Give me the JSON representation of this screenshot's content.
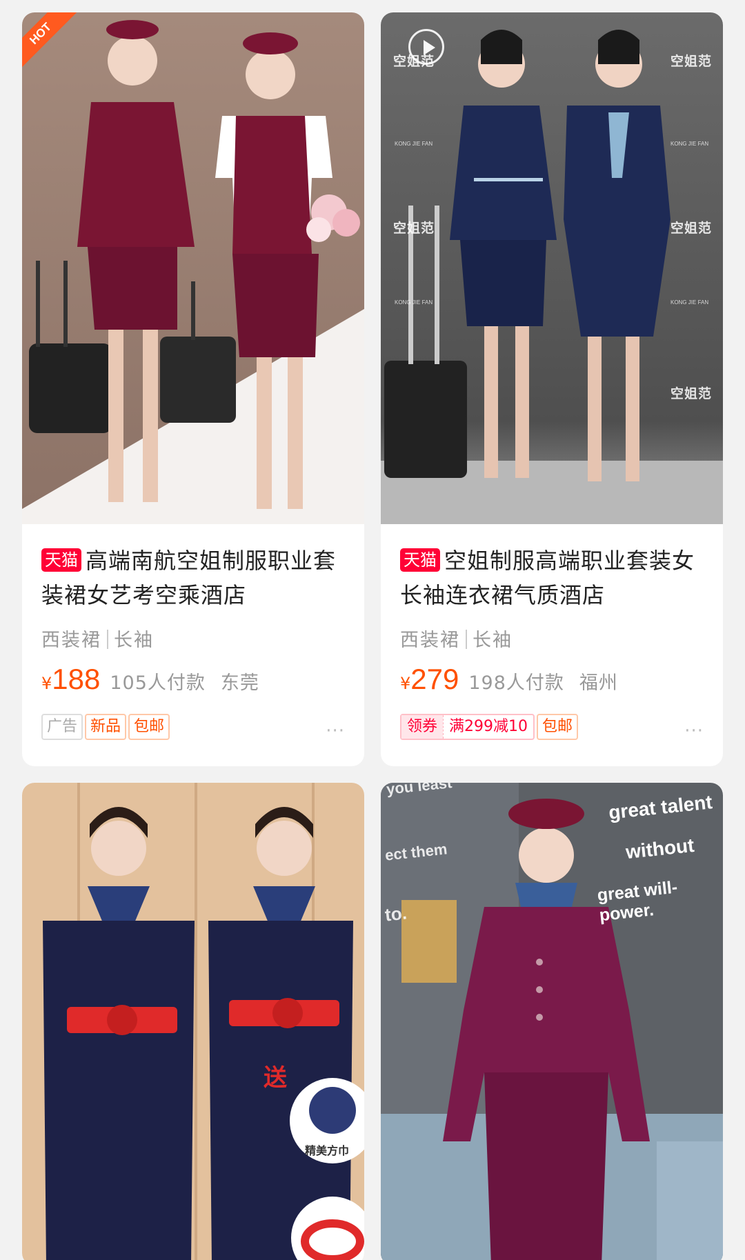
{
  "products": [
    {
      "badge": "HOT",
      "brand_tag": "天猫",
      "title": "高端南航空姐制服职业套装裙女艺考空乘酒店",
      "props": [
        "西装裙",
        "长袖"
      ],
      "currency": "¥",
      "price": "188",
      "sales": "105人付款",
      "city": "东莞",
      "tags": [
        "广告",
        "新品",
        "包邮"
      ],
      "more": "···"
    },
    {
      "watermark": "空姐范",
      "watermark_small": "KONG JIE FAN",
      "brand_tag": "天猫",
      "title": "空姐制服高端职业套装女长袖连衣裙气质酒店",
      "props": [
        "西装裙",
        "长袖"
      ],
      "currency": "¥",
      "price": "279",
      "sales": "198人付款",
      "city": "福州",
      "coupon": {
        "label": "领券",
        "text": "满299减10"
      },
      "tags": [
        "包邮"
      ],
      "more": "···"
    },
    {
      "promo_word": "送",
      "promo_item": "精美方巾"
    },
    {
      "slogan": [
        "great talent",
        "without",
        "great will-power."
      ],
      "bg_text": [
        "you least",
        "ect them",
        "to."
      ]
    }
  ],
  "colors": {
    "price": "#ff5000",
    "tmall": "#ff0036",
    "burgundy": "#7a1533",
    "navy": "#1e2a55"
  }
}
